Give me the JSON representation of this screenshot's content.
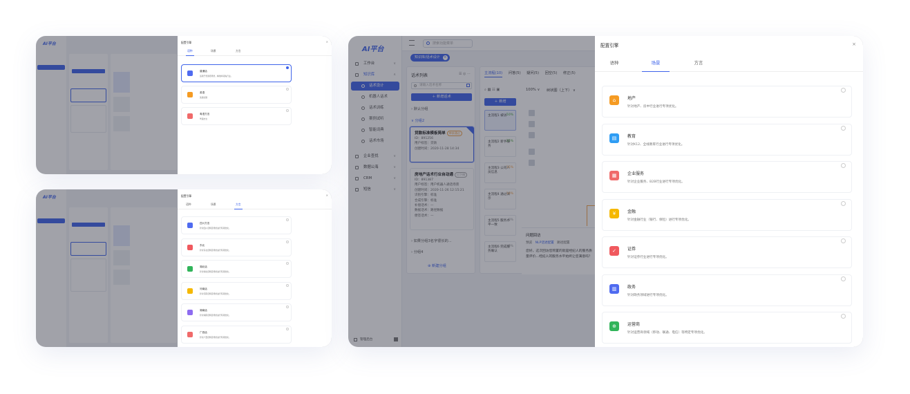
{
  "app": {
    "logo": "AI平台",
    "search_placeholder": "搜索功能菜单",
    "breadcrumb": "知识库/话术设计",
    "sidebar": [
      {
        "label": "工作台",
        "type": "top",
        "chev": "∨"
      },
      {
        "label": "知识库",
        "type": "top blue",
        "chev": "∧"
      },
      {
        "label": "话术设计",
        "type": "sub active"
      },
      {
        "label": "机器人话术",
        "type": "sub"
      },
      {
        "label": "话术训练",
        "type": "sub"
      },
      {
        "label": "案例试听",
        "type": "sub"
      },
      {
        "label": "智能词典",
        "type": "sub"
      },
      {
        "label": "话术市场",
        "type": "sub"
      },
      {
        "label": "企业查找",
        "type": "top",
        "chev": "∨"
      },
      {
        "label": "数据公海",
        "type": "top",
        "chev": "∨"
      },
      {
        "label": "CRM",
        "type": "top",
        "chev": "∨"
      },
      {
        "label": "短信",
        "type": "top",
        "chev": "∨"
      }
    ],
    "sidebar_footer": "管理后台",
    "list_panel": {
      "title": "话术列表",
      "search_placeholder": "请输入话术名称",
      "add_label": "＋ 新增话术",
      "group_default": "默认分组",
      "group_2": "分组2",
      "group_3": "如果分组3名字很长的...",
      "group_4": "分组4",
      "add_group": "新建分组",
      "cards": [
        {
          "title": "贷款标准模板简单",
          "tag": "审核通过",
          "id": "ID：891256",
          "rows": [
            "用户标签：贷款",
            "创建时间：2020-11-28 14:34"
          ]
        },
        {
          "title": "房地产话术行业自动通",
          "tag": "已下线",
          "id": "ID：891387",
          "rows": [
            "用户标签：用户机器人通话场景",
            "创建时间：2020-11-26 12:15:21",
            "识别引擎：标准",
            "合成引擎：标准",
            "补偿话术：—",
            "数据话术：路径数据",
            "便签话术：—"
          ]
        }
      ]
    },
    "flow_panel": {
      "tabs": [
        "主流程(10)",
        "问答(5)",
        "疑问(5)",
        "回空(5)",
        "修正(5)"
      ],
      "add_label": "＋ 新增",
      "zoom": "100%",
      "layout": "树状图（上下）",
      "steps": [
        {
          "name": "主流程1 被访",
          "pct": "50%",
          "color": "green"
        },
        {
          "name": "主流程2 新手服务",
          "pct": "25%",
          "color": "green"
        },
        {
          "name": "主流程3 公司人员信息",
          "pct": "15%",
          "color": "orange"
        },
        {
          "name": "主流程4 通过演示",
          "pct": "10%",
          "color": "orange"
        },
        {
          "name": "主流程5 服务水平一致",
          "pct": "0%",
          "color": "gray"
        },
        {
          "name": "主流程6 完成服务确认",
          "pct": "0%",
          "color": "gray"
        }
      ],
      "bottom_label": "问题回访",
      "bottom_tabs": [
        "预览",
        "NLP话述配置",
        "路径配置"
      ],
      "bottom_text": "您好，这次回访您购置的就是经纪人的服务质量评价...经纪人的服务水平始终让您满意吗？"
    },
    "drawer": {
      "title": "配置引擎",
      "close": "×",
      "tabs": [
        "语种",
        "场景",
        "方言"
      ],
      "active_tab": "场景",
      "items": [
        {
          "name": "地产",
          "desc": "针对地产、房中行业进行专项优化。",
          "icon": "building-icon",
          "color": "#f59b23",
          "glyph": "⌂"
        },
        {
          "name": "教育",
          "desc": "针对K12、全线教育行业进行专项优化。",
          "icon": "education-icon",
          "color": "#2f9df4",
          "glyph": "▤"
        },
        {
          "name": "企业服务",
          "desc": "针对企业服务、B2B行业进行专项优化。",
          "icon": "enterprise-icon",
          "color": "#f06a6a",
          "glyph": "▦"
        },
        {
          "name": "金融",
          "desc": "针对金融行业（银行、保险）进行专项优化。",
          "icon": "finance-icon",
          "color": "#f5b800",
          "glyph": "¥"
        },
        {
          "name": "证券",
          "desc": "针对证券行业进行专项优化。",
          "icon": "securities-icon",
          "color": "#f0595e",
          "glyph": "✓"
        },
        {
          "name": "政务",
          "desc": "针对政务领域进行专项优化。",
          "icon": "government-icon",
          "color": "#4f6bf0",
          "glyph": "▥"
        },
        {
          "name": "运营商",
          "desc": "针对运营商领域（移动、联通、电信）等特定专项优化。",
          "icon": "operator-icon",
          "color": "#31b45a",
          "glyph": "⊕"
        }
      ]
    }
  },
  "thumb1": {
    "drawer_title": "配置引擎",
    "tabs": [
      "语种",
      "场景",
      "方言"
    ],
    "active_tab": "语种",
    "items": [
      {
        "name": "普通话",
        "desc": "适用于普通话场景，精准率领先行业。",
        "color": "#4f6bf0",
        "selected": true
      },
      {
        "name": "英语",
        "desc": "英语识别",
        "color": "#f59b23",
        "selected": false
      },
      {
        "name": "粤语方言",
        "desc": "粤语方言",
        "color": "#f06a6a",
        "selected": false
      }
    ]
  },
  "thumb2": {
    "drawer_title": "配置引擎",
    "tabs": [
      "语种",
      "场景",
      "方言"
    ],
    "active_tab": "方言",
    "items": [
      {
        "name": "四川方言",
        "desc": "针对四川话特定场景进行专项优化。",
        "color": "#4f6bf0"
      },
      {
        "name": "东北",
        "desc": "针对东北话特定场景进行专项优化。",
        "color": "#f0595e"
      },
      {
        "name": "湖北话",
        "desc": "针对湖北话特定场景进行专项优化。",
        "color": "#31b45a"
      },
      {
        "name": "河南话",
        "desc": "针对河南话特定场景进行专项优化。",
        "color": "#f5b800"
      },
      {
        "name": "湖南话",
        "desc": "针对湖南话特定场景进行专项优化。",
        "color": "#8e6cf0"
      },
      {
        "name": "广西话",
        "desc": "针对广西话特定场景进行专项优化。",
        "color": "#f06a6a"
      }
    ]
  },
  "colors": {
    "accent": "#3e63ea",
    "overlay": "rgba(40,44,60,.44)"
  }
}
